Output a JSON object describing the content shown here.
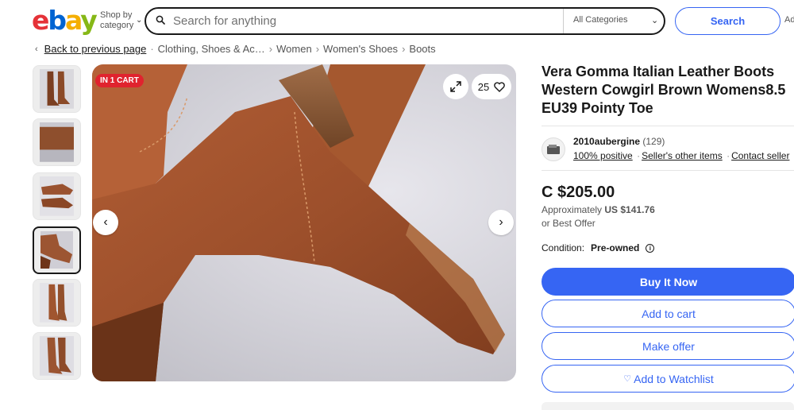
{
  "header": {
    "logo_letters": [
      "e",
      "b",
      "a",
      "y"
    ],
    "shop_by_line1": "Shop by",
    "shop_by_line2": "category",
    "search_placeholder": "Search for anything",
    "category_select": "All Categories",
    "search_button": "Search",
    "advanced_fragment": "Ad"
  },
  "breadcrumb": {
    "back": "Back to previous page",
    "items": [
      "Clothing, Shoes & Ac…",
      "Women",
      "Women's Shoes",
      "Boots"
    ]
  },
  "gallery": {
    "badge": "IN 1 CART",
    "watch_count": "25",
    "thumbnail_count": 6,
    "selected_thumbnail": 4
  },
  "listing": {
    "title": "Vera Gomma Italian Leather Boots Western Cowgirl Brown Womens8.5 EU39 Pointy Toe",
    "seller_name": "2010aubergine",
    "seller_feedback": "(129)",
    "seller_positive": "100% positive",
    "seller_other_items": "Seller's other items",
    "contact_seller": "Contact seller",
    "price": "C $205.00",
    "approx_prefix": "Approximately",
    "approx_value": "US $141.76",
    "best_offer": "or Best Offer",
    "condition_label": "Condition:",
    "condition_value": "Pre-owned",
    "buy_now": "Buy It Now",
    "add_to_cart": "Add to cart",
    "make_offer": "Make offer",
    "watchlist": "Add to Watchlist"
  },
  "colors": {
    "brand_blue": "#3665f3",
    "badge_red": "#e0232e",
    "boot_leather": "#a0522d"
  }
}
